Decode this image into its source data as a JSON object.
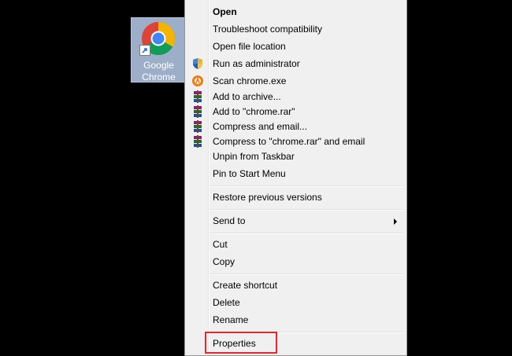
{
  "desktop_icon": {
    "label": "Google Chrome",
    "icon": "chrome-icon"
  },
  "menu": {
    "items": [
      {
        "label": "Open",
        "icon": null,
        "bold": true
      },
      {
        "label": "Troubleshoot compatibility",
        "icon": null
      },
      {
        "label": "Open file location",
        "icon": null
      },
      {
        "label": "Run as administrator",
        "icon": "uac-shield-icon"
      },
      {
        "label": "Scan chrome.exe",
        "icon": "antivirus-icon"
      },
      {
        "label": "Add to archive...",
        "icon": "winrar-icon"
      },
      {
        "label": "Add to \"chrome.rar\"",
        "icon": "winrar-icon"
      },
      {
        "label": "Compress and email...",
        "icon": "winrar-icon"
      },
      {
        "label": "Compress to \"chrome.rar\" and email",
        "icon": "winrar-icon"
      },
      {
        "label": "Unpin from Taskbar",
        "icon": null
      },
      {
        "label": "Pin to Start Menu",
        "icon": null
      },
      {
        "label": "Restore previous versions",
        "icon": null
      },
      {
        "label": "Send to",
        "icon": null,
        "submenu": true
      },
      {
        "label": "Cut",
        "icon": null
      },
      {
        "label": "Copy",
        "icon": null
      },
      {
        "label": "Create shortcut",
        "icon": null
      },
      {
        "label": "Delete",
        "icon": null
      },
      {
        "label": "Rename",
        "icon": null
      },
      {
        "label": "Properties",
        "icon": null,
        "highlighted": true
      }
    ]
  },
  "colors": {
    "highlight_box": "#e8262b",
    "menu_bg": "#f0f0f0",
    "icon_selection": "#9daec9"
  }
}
